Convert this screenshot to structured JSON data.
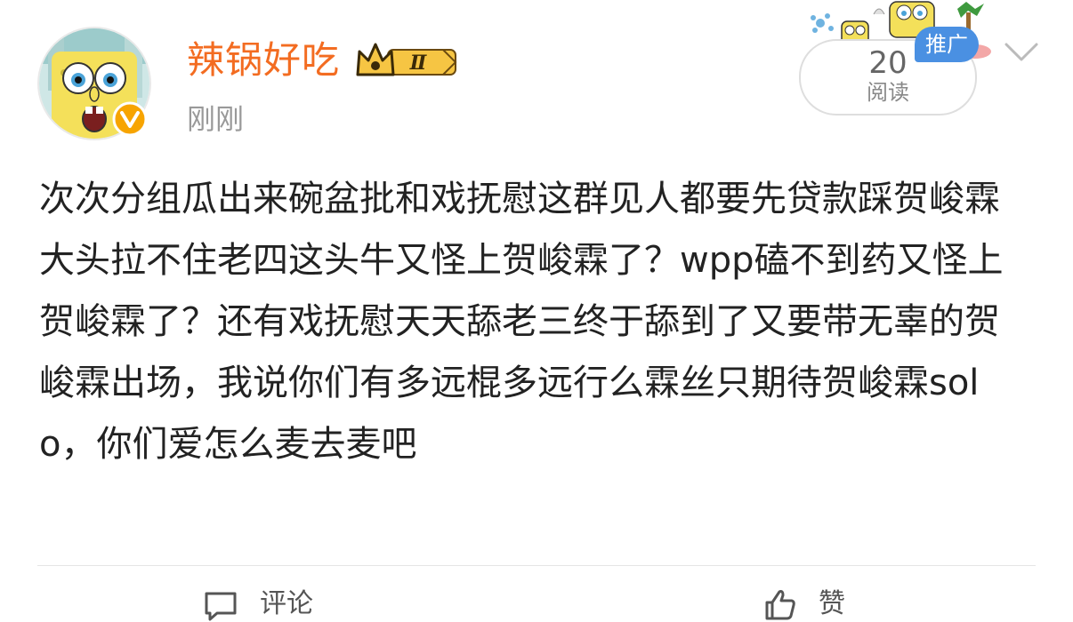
{
  "author": {
    "name": "辣锅好吃",
    "timestamp": "刚刚",
    "vip_level": "Ⅱ"
  },
  "ad": {
    "label": "推广",
    "read_count": "20",
    "read_label": "阅读"
  },
  "post": {
    "text": "次次分组瓜出来碗盆批和戏抚慰这群见人都要先贷款踩贺峻霖 大头拉不住老四这头牛又怪上贺峻霖了？wpp磕不到药又怪上贺峻霖了？还有戏抚慰天天舔老三终于舔到了又要带无辜的贺峻霖出场，我说你们有多远棍多远行么霖丝只期待贺峻霖solo，你们爱怎么麦去麦吧"
  },
  "actions": {
    "comment_label": "评论",
    "like_label": "赞"
  },
  "colors": {
    "username": "#f36c21",
    "ad_badge": "#4a90e2",
    "verified": "#f7a400",
    "text": "#222222",
    "muted": "#999999"
  }
}
